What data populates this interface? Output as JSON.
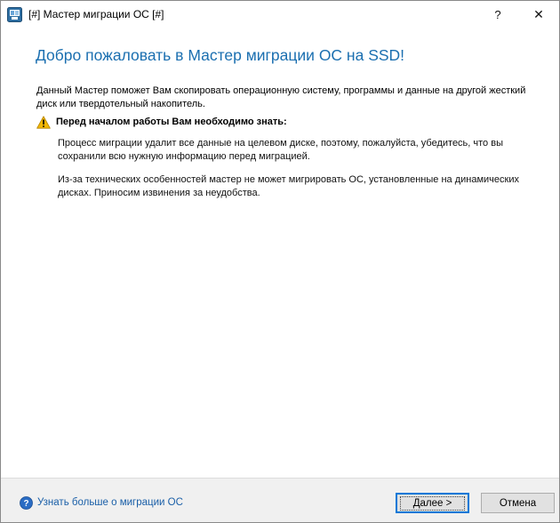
{
  "window": {
    "title": "[#] Мастер миграции ОС [#]",
    "help_glyph": "?",
    "close_glyph": "✕"
  },
  "content": {
    "heading": "Добро пожаловать в Мастер миграции ОС на SSD!",
    "intro": "Данный Мастер поможет Вам скопировать операционную систему, программы и данные на другой жесткий диск или твердотельный накопитель.",
    "warning_title": "Перед началом работы Вам необходимо знать:",
    "paragraph1": "Процесс миграции удалит все данные на целевом диске, поэтому, пожалуйста, убедитесь, что вы сохранили всю нужную информацию перед миграцией.",
    "paragraph2": "Из-за технических особенностей мастер не может мигрировать ОС, установленные на динамических дисках. Приносим извинения за неудобства."
  },
  "footer": {
    "help_link": "Узнать больше о миграции ОС",
    "next_button": "Далее >",
    "cancel_button": "Отмена"
  },
  "colors": {
    "heading": "#1b6fb0",
    "link": "#1a5fa8",
    "footer_bg": "#f0f0f0",
    "warning": "#f2b705",
    "focus": "#0078d7"
  },
  "icons": {
    "app": "migration-app-icon",
    "warning": "warning-icon",
    "help": "question-circle-icon"
  }
}
